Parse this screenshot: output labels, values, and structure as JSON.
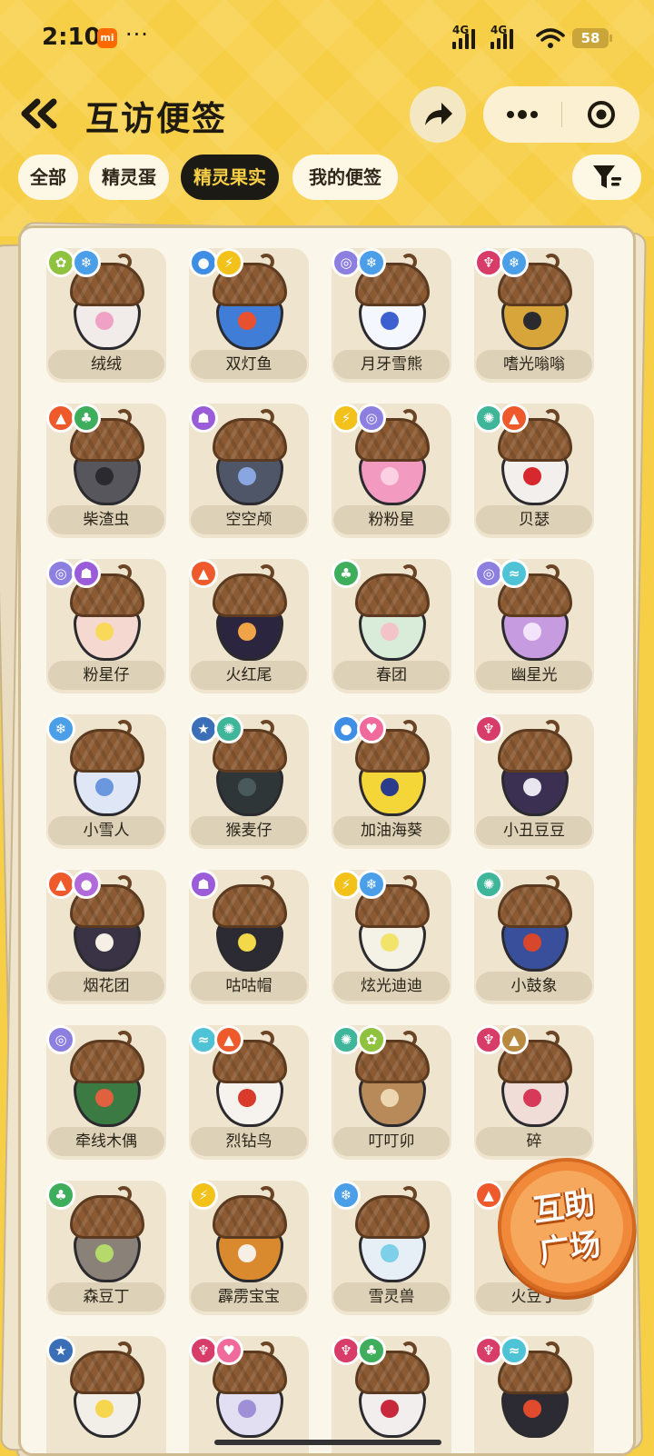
{
  "status_bar": {
    "time": "2:10",
    "app_badge": "mi",
    "more": "···",
    "net1": "4G",
    "net2": "4G",
    "battery": "58"
  },
  "header": {
    "title": "互访便签"
  },
  "tabs": [
    {
      "label": "全部",
      "active": false
    },
    {
      "label": "精灵蛋",
      "active": false
    },
    {
      "label": "精灵果实",
      "active": true
    },
    {
      "label": "我的便签",
      "active": false
    }
  ],
  "items": [
    {
      "name": "绒绒",
      "elements": [
        "bug",
        "ice"
      ],
      "body_color": "#f1ece9",
      "mark_color": "#f0a2c6"
    },
    {
      "name": "双灯鱼",
      "elements": [
        "water",
        "electric"
      ],
      "body_color": "#3f7dd6",
      "mark_color": "#e9502f"
    },
    {
      "name": "月牙雪熊",
      "elements": [
        "psychic",
        "ice"
      ],
      "body_color": "#f5f7ff",
      "mark_color": "#3d60d0"
    },
    {
      "name": "嗜光嗡嗡",
      "elements": [
        "dark",
        "ice"
      ],
      "body_color": "#d8a53b",
      "mark_color": "#2b2a2e"
    },
    {
      "name": "柴渣虫",
      "elements": [
        "fire",
        "grass"
      ],
      "body_color": "#57565c",
      "mark_color": "#2b2a2e"
    },
    {
      "name": "空空颅",
      "elements": [
        "ghost"
      ],
      "body_color": "#4f5667",
      "mark_color": "#8aa6e0"
    },
    {
      "name": "粉粉星",
      "elements": [
        "electric",
        "psychic"
      ],
      "body_color": "#f29abf",
      "mark_color": "#fbd0e2"
    },
    {
      "name": "贝瑟",
      "elements": [
        "normal",
        "fire"
      ],
      "body_color": "#f3efec",
      "mark_color": "#d8282f"
    },
    {
      "name": "粉星仔",
      "elements": [
        "psychic",
        "ghost"
      ],
      "body_color": "#f5d9d0",
      "mark_color": "#f8d95a"
    },
    {
      "name": "火红尾",
      "elements": [
        "fire"
      ],
      "body_color": "#2c2540",
      "mark_color": "#f0a447"
    },
    {
      "name": "春团",
      "elements": [
        "grass"
      ],
      "body_color": "#d9ecd9",
      "mark_color": "#f2c4c9"
    },
    {
      "name": "幽星光",
      "elements": [
        "psychic",
        "flying"
      ],
      "body_color": "#c79be0",
      "mark_color": "#f3e3fb"
    },
    {
      "name": "小雪人",
      "elements": [
        "ice"
      ],
      "body_color": "#dfe7f7",
      "mark_color": "#6b97de"
    },
    {
      "name": "猴麦仔",
      "elements": [
        "star",
        "normal"
      ],
      "body_color": "#2f3638",
      "mark_color": "#4a5a5c"
    },
    {
      "name": "加油海葵",
      "elements": [
        "water",
        "fairy"
      ],
      "body_color": "#f5d638",
      "mark_color": "#2b3c8c"
    },
    {
      "name": "小丑豆豆",
      "elements": [
        "dark"
      ],
      "body_color": "#3b2f52",
      "mark_color": "#e9e6f0"
    },
    {
      "name": "烟花团",
      "elements": [
        "fire",
        "poison"
      ],
      "body_color": "#3a3346",
      "mark_color": "#f5efe6"
    },
    {
      "name": "咕咕帽",
      "elements": [
        "ghost"
      ],
      "body_color": "#2c2a33",
      "mark_color": "#f3d84a"
    },
    {
      "name": "炫光迪迪",
      "elements": [
        "electric",
        "ice"
      ],
      "body_color": "#f4f2e6",
      "mark_color": "#f2e36a"
    },
    {
      "name": "小鼓象",
      "elements": [
        "normal"
      ],
      "body_color": "#3a4f9c",
      "mark_color": "#d8462c"
    },
    {
      "name": "牵线木偶",
      "elements": [
        "psychic"
      ],
      "body_color": "#3c7a43",
      "mark_color": "#e0603f"
    },
    {
      "name": "烈钻鸟",
      "elements": [
        "flying",
        "fire"
      ],
      "body_color": "#f6f3ef",
      "mark_color": "#d83a2c"
    },
    {
      "name": "叮叮卯",
      "elements": [
        "normal",
        "bug"
      ],
      "body_color": "#b88a5a",
      "mark_color": "#ecd7b0"
    },
    {
      "name": "碎",
      "elements": [
        "dark",
        "ground"
      ],
      "body_color": "#f1ddd7",
      "mark_color": "#d73a58"
    },
    {
      "name": "森豆丁",
      "elements": [
        "grass"
      ],
      "body_color": "#8a8278",
      "mark_color": "#b5d96a"
    },
    {
      "name": "霹雳宝宝",
      "elements": [
        "electric"
      ],
      "body_color": "#d98a2e",
      "mark_color": "#f7efe5"
    },
    {
      "name": "雪灵兽",
      "elements": [
        "ice"
      ],
      "body_color": "#e6eef6",
      "mark_color": "#7ed0e8"
    },
    {
      "name": "火豆丁",
      "elements": [
        "fire"
      ],
      "body_color": "#e8e3dd",
      "mark_color": "#3a3a3a"
    },
    {
      "name": "",
      "elements": [
        "star"
      ],
      "body_color": "#f2efe9",
      "mark_color": "#f5d64e"
    },
    {
      "name": "",
      "elements": [
        "dark",
        "fairy"
      ],
      "body_color": "#e3dff2",
      "mark_color": "#9f8fd6"
    },
    {
      "name": "",
      "elements": [
        "dark",
        "grass"
      ],
      "body_color": "#f3eeee",
      "mark_color": "#c8283c"
    },
    {
      "name": "",
      "elements": [
        "dark",
        "flying"
      ],
      "body_color": "#2c2b33",
      "mark_color": "#e04a2d"
    }
  ],
  "element_colors": {
    "bug": "#8fc23e",
    "ice": "#4b9fe8",
    "water": "#3f8ee6",
    "electric": "#f2c11a",
    "psychic": "#8d7fe0",
    "dark": "#d83d6a",
    "fire": "#ee5a2c",
    "grass": "#3fae5c",
    "ghost": "#9b5cd9",
    "normal": "#3fb59a",
    "flying": "#4fc3d6",
    "fairy": "#f06a9c",
    "star": "#3a6fb8",
    "poison": "#b06ad9",
    "ground": "#b8893f"
  },
  "element_icons": {
    "bug": "ladybug-icon",
    "ice": "snowflake-icon",
    "water": "droplet-icon",
    "electric": "lightning-icon",
    "psychic": "spiral-icon",
    "dark": "demon-icon",
    "fire": "flame-icon",
    "grass": "leaf-icon",
    "ghost": "ghost-icon",
    "normal": "gear-icon",
    "flying": "wing-icon",
    "fairy": "heart-icon",
    "star": "star-icon",
    "poison": "bubble-icon",
    "ground": "mountain-icon"
  },
  "element_glyphs": {
    "bug": "✿",
    "ice": "❄",
    "water": "●",
    "electric": "⚡",
    "psychic": "◎",
    "dark": "♆",
    "fire": "▲",
    "grass": "♣",
    "ghost": "☗",
    "normal": "✺",
    "flying": "≈",
    "fairy": "♥",
    "star": "★",
    "poison": "●",
    "ground": "▲"
  },
  "sticker": {
    "line1": "互助",
    "line2": "广场"
  }
}
